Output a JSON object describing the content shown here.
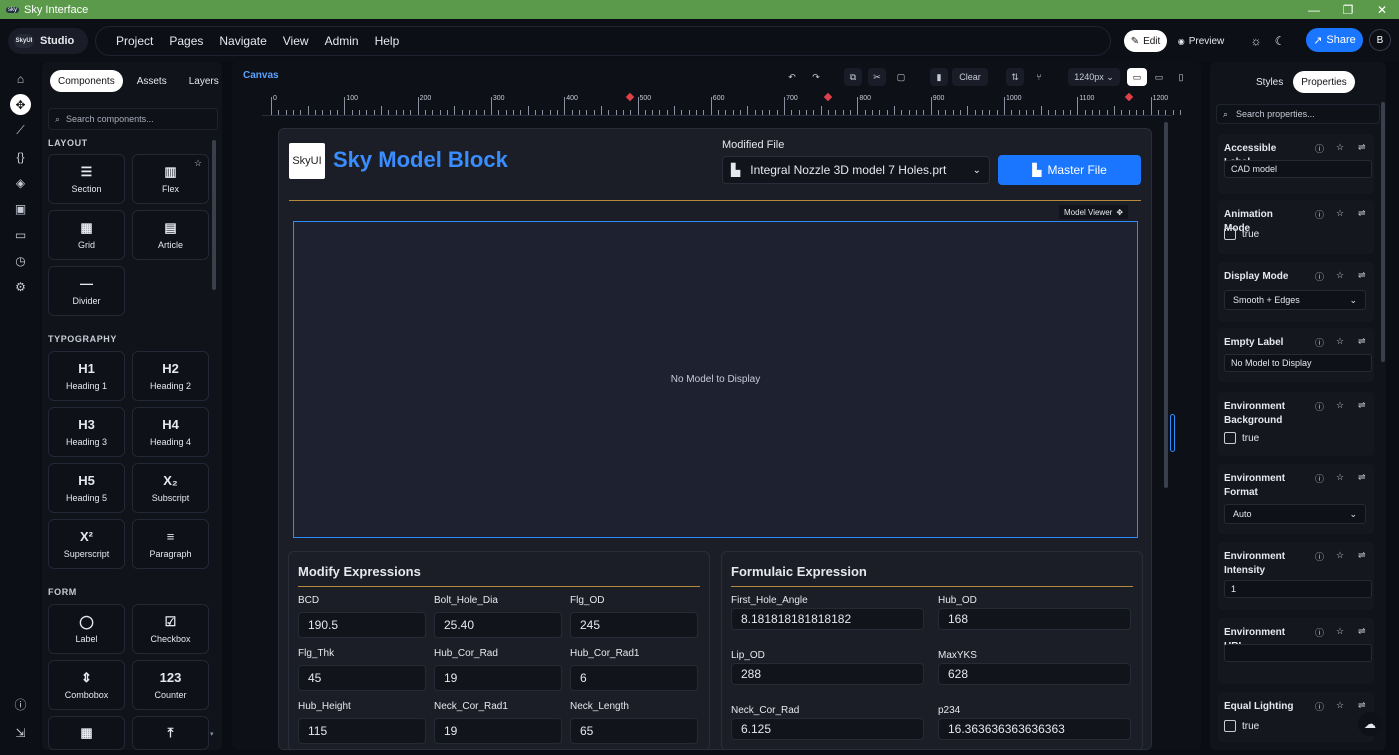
{
  "window": {
    "title": "Sky Interface",
    "minimize": "—",
    "maximize": "❐",
    "close": "✕"
  },
  "topnav": {
    "brand": "Studio",
    "brand_logo": "SkyUI",
    "menus": [
      "Project",
      "Pages",
      "Navigate",
      "View",
      "Admin",
      "Help"
    ],
    "edit": "Edit",
    "preview": "Preview",
    "share": "Share",
    "avatar": "B"
  },
  "components": {
    "tabs": [
      "Components",
      "Assets",
      "Layers"
    ],
    "search_placeholder": "Search components...",
    "sections": {
      "layout": "LAYOUT",
      "typography": "TYPOGRAPHY",
      "form": "FORM"
    },
    "layout_items": [
      {
        "icon": "☰",
        "label": "Section"
      },
      {
        "icon": "▥",
        "label": "Flex"
      },
      {
        "icon": "▦",
        "label": "Grid"
      },
      {
        "icon": "▤",
        "label": "Article"
      },
      {
        "icon": "—",
        "label": "Divider"
      }
    ],
    "typography_items": [
      {
        "icon": "H1",
        "label": "Heading 1"
      },
      {
        "icon": "H2",
        "label": "Heading 2"
      },
      {
        "icon": "H3",
        "label": "Heading 3"
      },
      {
        "icon": "H4",
        "label": "Heading 4"
      },
      {
        "icon": "H5",
        "label": "Heading 5"
      },
      {
        "icon": "X₂",
        "label": "Subscript"
      },
      {
        "icon": "X²",
        "label": "Superscript"
      },
      {
        "icon": "≡",
        "label": "Paragraph"
      }
    ],
    "form_items": [
      {
        "icon": "◯",
        "label": "Label"
      },
      {
        "icon": "☑",
        "label": "Checkbox"
      },
      {
        "icon": "⇕",
        "label": "Combobox"
      },
      {
        "icon": "123",
        "label": "Counter"
      },
      {
        "icon": "▦",
        "label": ""
      },
      {
        "icon": "⤒",
        "label": ""
      }
    ]
  },
  "canvas": {
    "title": "Canvas",
    "clear": "Clear",
    "width_select": "1240px ⌄",
    "ruler": [
      "0",
      "100",
      "200",
      "300",
      "400",
      "500",
      "600",
      "700",
      "800",
      "900",
      "1000",
      "1100",
      "1200"
    ]
  },
  "block": {
    "logo": "SkyUI",
    "title": "Sky Model Block",
    "modified_label": "Modified File",
    "file_name": "Integral Nozzle 3D model 7 Holes.prt",
    "master_button": "Master File",
    "viewer_badge": "Model Viewer",
    "viewer_empty": "No Model to Display"
  },
  "modify": {
    "title": "Modify Expressions",
    "fields": [
      {
        "label": "BCD",
        "value": "190.5"
      },
      {
        "label": "Bolt_Hole_Dia",
        "value": "25.40"
      },
      {
        "label": "Flg_OD",
        "value": "245"
      },
      {
        "label": "Flg_Thk",
        "value": "45"
      },
      {
        "label": "Hub_Cor_Rad",
        "value": "19"
      },
      {
        "label": "Hub_Cor_Rad1",
        "value": "6"
      },
      {
        "label": "Hub_Height",
        "value": "115"
      },
      {
        "label": "Neck_Cor_Rad1",
        "value": "19"
      },
      {
        "label": "Neck_Length",
        "value": "65"
      }
    ]
  },
  "formulaic": {
    "title": "Formulaic Expression",
    "fields": [
      {
        "label": "First_Hole_Angle",
        "value": "8.181818181818182"
      },
      {
        "label": "Hub_OD",
        "value": "168"
      },
      {
        "label": "Lip_OD",
        "value": "288"
      },
      {
        "label": "MaxYKS",
        "value": "628"
      },
      {
        "label": "Neck_Cor_Rad",
        "value": "6.125"
      },
      {
        "label": "p234",
        "value": "16.363636363636363"
      }
    ]
  },
  "properties": {
    "tabs": [
      "Styles",
      "Properties"
    ],
    "search_placeholder": "Search properties...",
    "items": [
      {
        "label": "Accessible Label",
        "type": "input",
        "value": "CAD model"
      },
      {
        "label": "Animation Mode",
        "type": "check",
        "value": "true"
      },
      {
        "label": "Display Mode",
        "type": "select",
        "value": "Smooth + Edges"
      },
      {
        "label": "Empty Label",
        "type": "input",
        "value": "No Model to Display"
      },
      {
        "label": "Environment Background",
        "type": "check",
        "value": "true"
      },
      {
        "label": "Environment Format",
        "type": "select",
        "value": "Auto"
      },
      {
        "label": "Environment Intensity",
        "type": "input",
        "value": "1"
      },
      {
        "label": "Environment URL",
        "type": "input",
        "value": ""
      },
      {
        "label": "Equal Lighting",
        "type": "check",
        "value": "true"
      }
    ]
  }
}
